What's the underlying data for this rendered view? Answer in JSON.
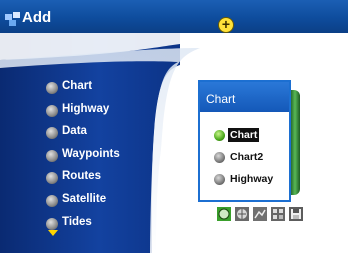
{
  "window": {
    "title": "Add",
    "add_button_symbol": "+"
  },
  "menu": {
    "items": [
      {
        "label": "Chart",
        "icon": "globe-icon"
      },
      {
        "label": "Highway",
        "icon": "globe-icon"
      },
      {
        "label": "Data",
        "icon": "globe-icon"
      },
      {
        "label": "Waypoints",
        "icon": "globe-icon"
      },
      {
        "label": "Routes",
        "icon": "globe-icon"
      },
      {
        "label": "Satellite",
        "icon": "globe-icon"
      },
      {
        "label": "Tides",
        "icon": "globe-icon"
      }
    ],
    "more_indicator": "chevron-down-icon"
  },
  "popup": {
    "title": "Chart",
    "options": [
      {
        "label": "Chart",
        "selected": true
      },
      {
        "label": "Chart2",
        "selected": false
      },
      {
        "label": "Highway",
        "selected": false
      }
    ]
  },
  "toolbar": {
    "buttons": [
      {
        "icon": "globe-icon"
      },
      {
        "icon": "globe-icon"
      },
      {
        "icon": "chart-icon"
      },
      {
        "icon": "grid-icon"
      },
      {
        "icon": "save-icon"
      }
    ]
  },
  "colors": {
    "titlebar": "#0e4c9d",
    "menu_bg": "#0d3585",
    "popup_border": "#1c6fd1",
    "accent_yellow": "#ffd400",
    "accent_green": "#3aa02c"
  }
}
